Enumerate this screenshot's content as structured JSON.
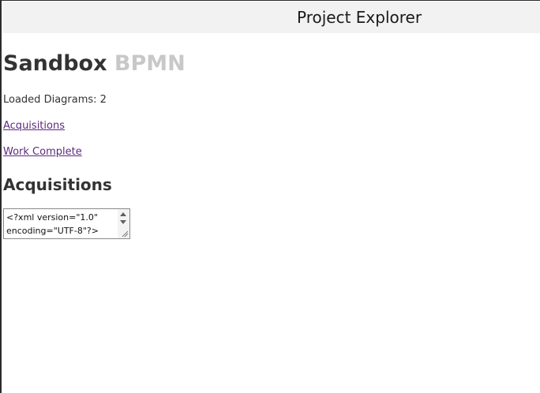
{
  "window": {
    "title": "Project Explorer"
  },
  "page": {
    "heading_brand": "Sandbox",
    "heading_sub": "BPMN",
    "loaded_label": "Loaded Diagrams: 2"
  },
  "diagrams": [
    {
      "label": "Acquisitions"
    },
    {
      "label": "Work Complete"
    }
  ],
  "selected": {
    "heading": "Acquisitions",
    "xml_value": "<?xml version=\"1.0\" encoding=\"UTF-8\"?>"
  },
  "colors": {
    "titlebar_bg": "#f2f2f2",
    "link": "#5c2a7d",
    "heading_sub": "#c8c8c8",
    "text": "#333333"
  },
  "icons": [
    "scroll-up-icon",
    "scroll-down-icon",
    "resize-grip-icon"
  ]
}
